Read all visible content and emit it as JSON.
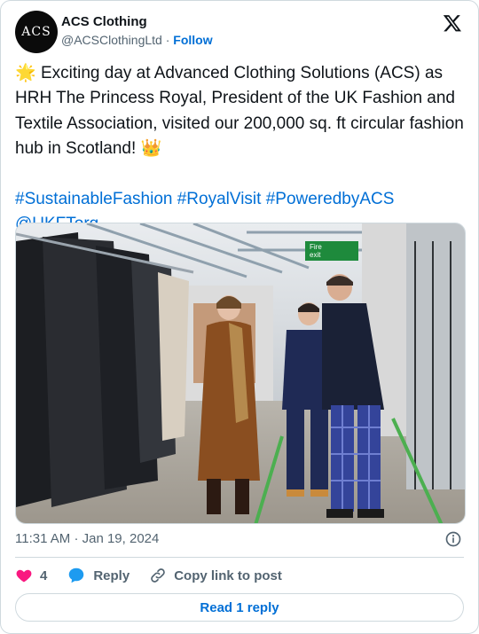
{
  "author": {
    "avatar_text": "ACS",
    "display_name": "ACS Clothing",
    "handle": "@ACSClothingLtd",
    "separator": "·",
    "follow_label": "Follow"
  },
  "tweet": {
    "sun_emoji": "🌟",
    "body": " Exciting day at Advanced Clothing Solutions (ACS) as HRH The Princess Royal, President of the UK Fashion and Textile Association, visited our 200,000 sq. ft circular fashion hub in Scotland! ",
    "crown_emoji": "👑",
    "hashtags": "#SustainableFashion #RoyalVisit #PoweredbyACS",
    "mention": "@UKFTorg"
  },
  "media": {
    "sign_text_1": "Fire",
    "sign_text_2": "exit"
  },
  "meta": {
    "time": "11:31 AM",
    "separator": "·",
    "date": "Jan 19, 2024"
  },
  "actions": {
    "like_count": "4",
    "reply_label": "Reply",
    "copy_label": "Copy link to post"
  },
  "footer": {
    "read_reply_label": "Read 1 reply"
  },
  "colors": {
    "link": "#006fd6",
    "like": "#f91880",
    "reply": "#1d9bf0",
    "muted": "#536471"
  }
}
